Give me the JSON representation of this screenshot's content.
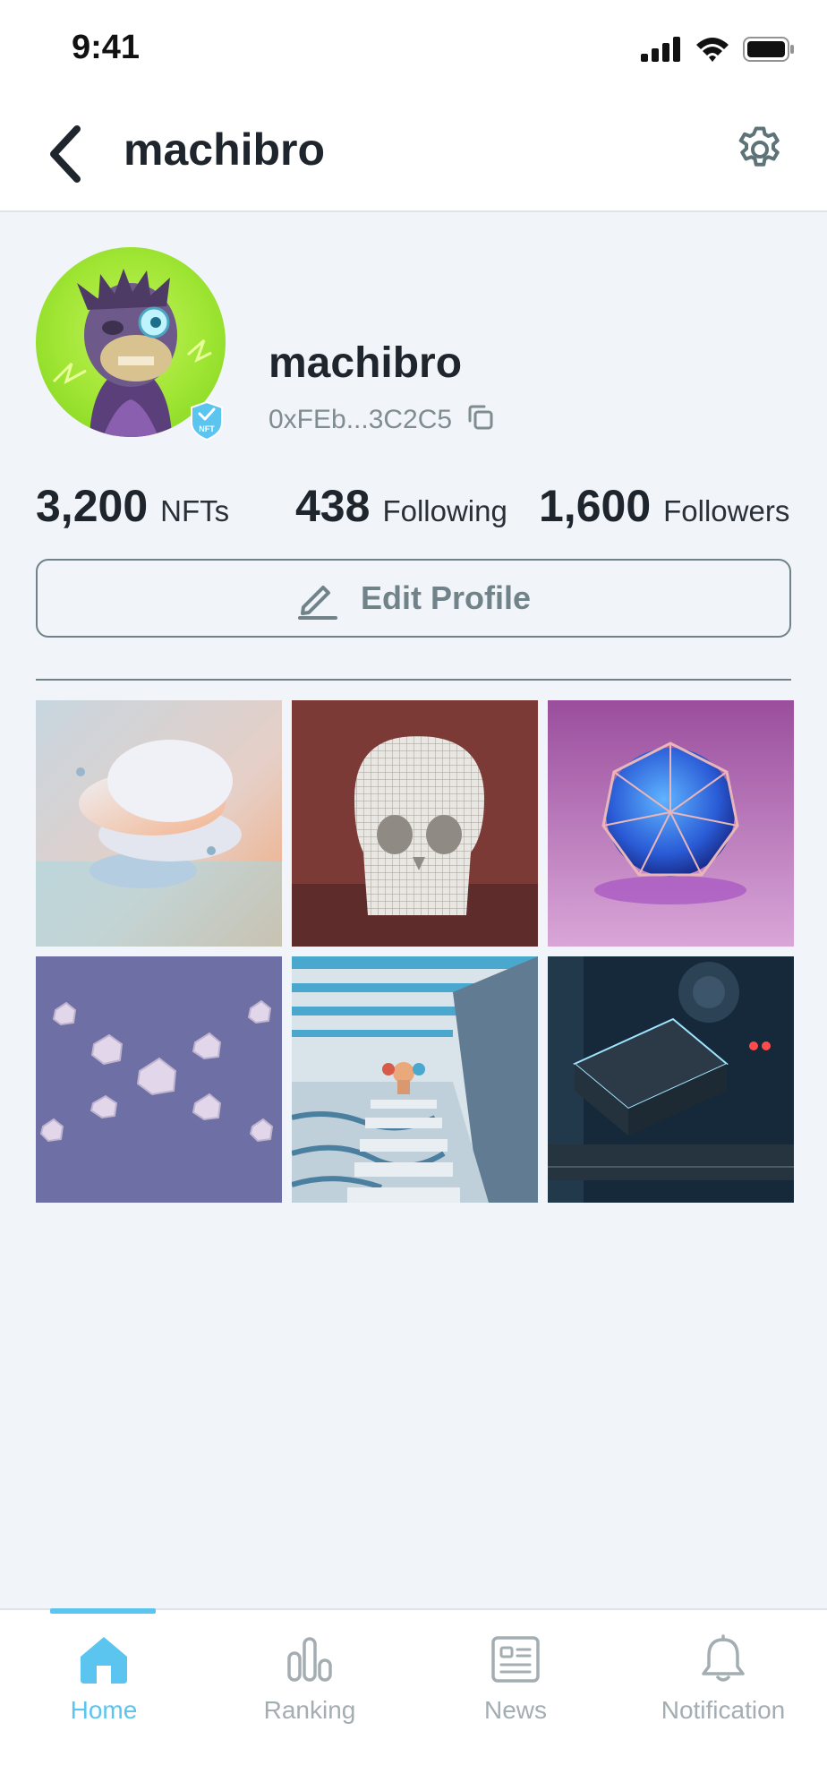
{
  "status_bar": {
    "time": "9:41",
    "icons": [
      "cellular-signal-icon",
      "wifi-icon",
      "battery-icon"
    ]
  },
  "header": {
    "title": "machibro",
    "back_icon": "chevron-left-icon",
    "settings_icon": "gear-icon"
  },
  "profile": {
    "name": "machibro",
    "wallet_address": "0xFEb...3C2C5",
    "copy_icon": "copy-icon",
    "badge_label": "NFT",
    "avatar": "ape-avatar"
  },
  "stats": [
    {
      "value": "3,200",
      "label": "NFTs"
    },
    {
      "value": "438",
      "label": "Following"
    },
    {
      "value": "1,600",
      "label": "Followers"
    }
  ],
  "edit_profile": {
    "label": "Edit Profile",
    "icon": "pencil-icon"
  },
  "gallery": {
    "items": [
      "abstract-discs",
      "wireframe-skull",
      "cage-sphere",
      "floating-dice",
      "stairs-scene",
      "gpu-hardware"
    ]
  },
  "tab_bar": {
    "active_index": 0,
    "items": [
      {
        "label": "Home",
        "icon": "home-icon"
      },
      {
        "label": "Ranking",
        "icon": "bar-chart-icon"
      },
      {
        "label": "News",
        "icon": "newspaper-icon"
      },
      {
        "label": "Notification",
        "icon": "bell-icon"
      }
    ]
  },
  "colors": {
    "accent": "#5bc4ef",
    "muted": "#6f8389",
    "background": "#f1f4f9",
    "text": "#1f252d",
    "inactive": "#a3adb2"
  }
}
